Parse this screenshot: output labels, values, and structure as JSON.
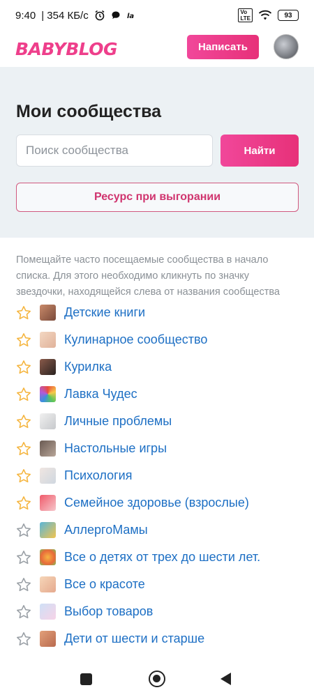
{
  "status_bar": {
    "time": "9:40",
    "network_speed": "| 354 КБ/с",
    "battery": "93",
    "icons": [
      "alarm-icon",
      "chat-icon",
      "la-icon",
      "volte-icon",
      "wifi-icon",
      "battery-icon"
    ]
  },
  "header": {
    "logo": "BABYBLOG",
    "write_button": "Написать",
    "accent_color": "#ee3f8b"
  },
  "main": {
    "title": "Мои сообщества",
    "search": {
      "placeholder": "Поиск сообщества",
      "value": "",
      "button": "Найти"
    },
    "resource_button": "Ресурс при выгорании",
    "hint": "Помещайте часто посещаемые сообщества в начало списка. Для этого необходимо кликнуть по значку звездочки, находящейся слева от названия сообщества"
  },
  "communities": [
    {
      "label": "Детские книги",
      "starred": true
    },
    {
      "label": "Кулинарное сообщество",
      "starred": true
    },
    {
      "label": "Курилка",
      "starred": true
    },
    {
      "label": "Лавка Чудес",
      "starred": true
    },
    {
      "label": "Личные проблемы",
      "starred": true
    },
    {
      "label": "Настольные игры",
      "starred": true
    },
    {
      "label": "Психология",
      "starred": true
    },
    {
      "label": "Семейное здоровье (взрослые)",
      "starred": true
    },
    {
      "label": "АллергоМамы",
      "starred": false
    },
    {
      "label": "Все о детях от трех до шести лет.",
      "starred": false
    },
    {
      "label": "Все о красоте",
      "starred": false
    },
    {
      "label": "Выбор товаров",
      "starred": false
    },
    {
      "label": "Дети от шести и старше",
      "starred": false
    }
  ],
  "colors": {
    "star_active": "#f5b53f",
    "star_inactive": "#9aa0a6",
    "link": "#1d6fc4"
  }
}
